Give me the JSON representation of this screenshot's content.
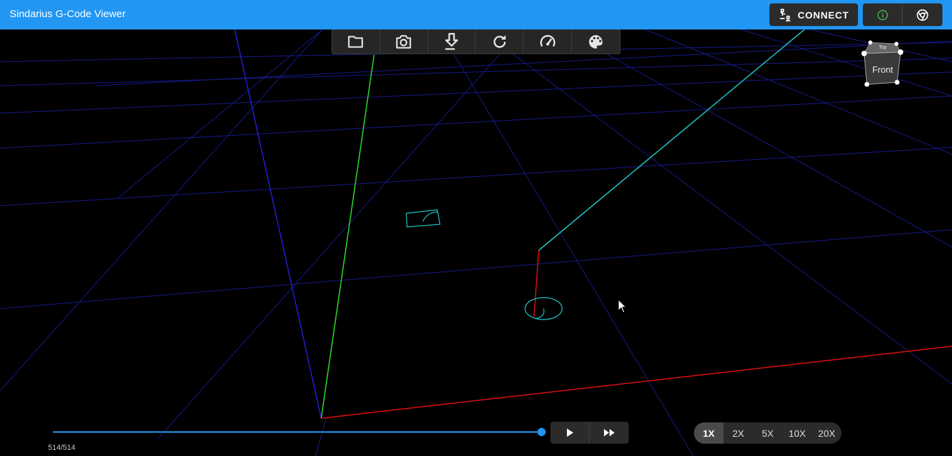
{
  "app": {
    "title": "Sindarius G-Code Viewer"
  },
  "appbar": {
    "connect_label": "CONNECT",
    "connect_icon": "lan-connect-icon",
    "info_icon": "info-icon",
    "chrome_icon": "chrome-icon"
  },
  "toolbar": {
    "items": [
      {
        "name": "open-file",
        "icon": "folder-icon"
      },
      {
        "name": "screenshot",
        "icon": "camera-icon"
      },
      {
        "name": "download",
        "icon": "download-icon"
      },
      {
        "name": "reset",
        "icon": "refresh-icon"
      },
      {
        "name": "performance",
        "icon": "speedometer-icon"
      },
      {
        "name": "colors",
        "icon": "palette-icon"
      }
    ]
  },
  "view_cube": {
    "top_label": "Top",
    "front_label": "Front"
  },
  "playback": {
    "progress_text": "514/514",
    "position": 514,
    "total": 514,
    "play_icon": "play-icon",
    "fast_forward_icon": "fast-forward-icon"
  },
  "speed": {
    "options": [
      "1X",
      "2X",
      "5X",
      "10X",
      "20X"
    ],
    "selected": "1X"
  },
  "colors": {
    "accent": "#2196f3",
    "grid": "#1a1f9e",
    "x_axis": "#e01010",
    "y_axis": "#2de02d",
    "z_axis": "#2020ff",
    "toolpath": "#20c8c8",
    "travel": "#e01010"
  }
}
